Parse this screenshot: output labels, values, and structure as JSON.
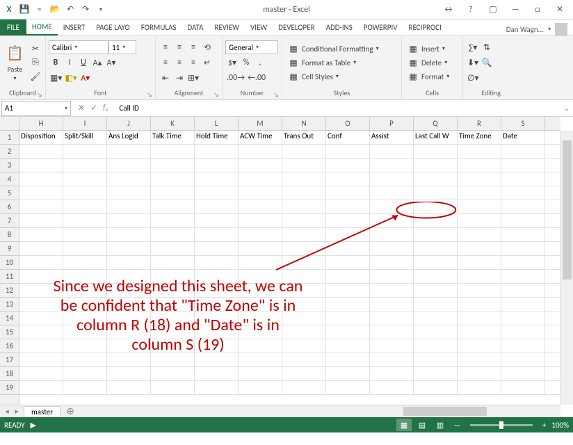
{
  "window": {
    "title": "master - Excel"
  },
  "user": {
    "name": "Dan Wagn..."
  },
  "tabs": [
    "FILE",
    "HOME",
    "INSERT",
    "PAGE LAYO",
    "FORMULAS",
    "DATA",
    "REVIEW",
    "VIEW",
    "DEVELOPER",
    "ADD-INS",
    "POWERPIV",
    "RECIPROCI"
  ],
  "active_tab": "HOME",
  "ribbon": {
    "clipboard": {
      "paste": "Paste",
      "label": "Clipboard"
    },
    "font": {
      "name": "Calibri",
      "size": "11",
      "label": "Font"
    },
    "alignment": {
      "label": "Alignment"
    },
    "number": {
      "format": "General",
      "label": "Number"
    },
    "styles": {
      "cond": "Conditional Formatting",
      "table": "Format as Table",
      "cell": "Cell Styles",
      "label": "Styles"
    },
    "cells": {
      "insert": "Insert",
      "delete": "Delete",
      "format": "Format",
      "label": "Cells"
    },
    "editing": {
      "label": "Editing"
    }
  },
  "namebox": "A1",
  "formula": "Call ID",
  "columns": [
    "H",
    "I",
    "J",
    "K",
    "L",
    "M",
    "N",
    "O",
    "P",
    "Q",
    "R",
    "S"
  ],
  "headers": [
    "Disposition",
    "Split/Skill",
    "Ans Logid",
    "Talk Time",
    "Hold Time",
    "ACW Time",
    "Trans Out",
    "Conf",
    "Assist",
    "Last Call W",
    "Time Zone",
    "Date"
  ],
  "row_count": 19,
  "sheet": "master",
  "status": "READY",
  "zoom": "100%",
  "annotation": "Since we designed this sheet, we can be confident that \"Time Zone\" is in column R (18) and \"Date\" is in column S (19)"
}
